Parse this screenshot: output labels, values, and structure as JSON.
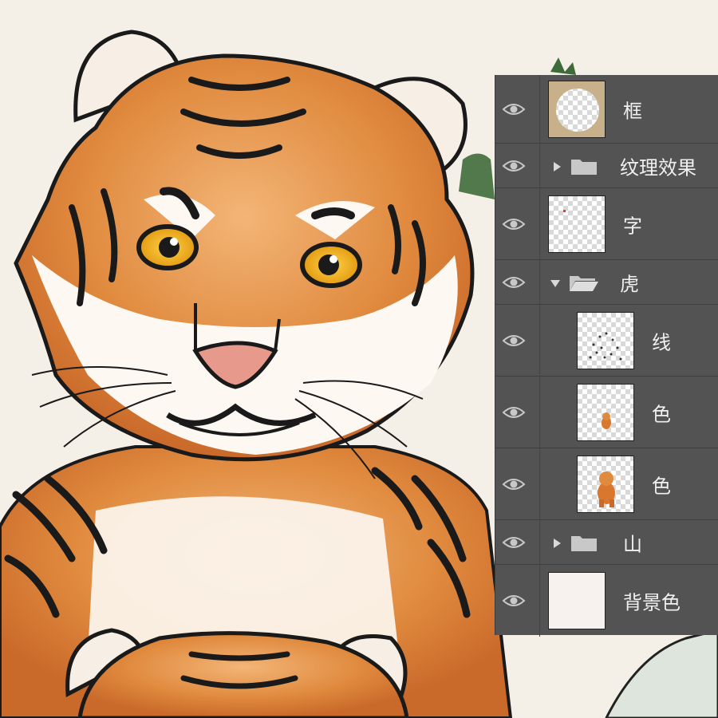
{
  "layers_panel": {
    "layers": [
      {
        "name": "框",
        "kind": "layer",
        "thumbnail": "frame-thumbnail"
      },
      {
        "name": "纹理效果",
        "kind": "group",
        "expanded": false
      },
      {
        "name": "字",
        "kind": "layer",
        "thumbnail": "transparent-thumbnail"
      },
      {
        "name": "虎",
        "kind": "group",
        "expanded": true
      },
      {
        "name": "线",
        "kind": "layer",
        "indented": true,
        "thumbnail": "linework-thumbnail"
      },
      {
        "name": "色",
        "kind": "layer",
        "indented": true,
        "thumbnail": "small-tiger-thumbnail"
      },
      {
        "name": "色",
        "kind": "layer",
        "indented": true,
        "thumbnail": "tiger-color-thumbnail"
      },
      {
        "name": "山",
        "kind": "group",
        "expanded": false
      },
      {
        "name": "背景色",
        "kind": "layer",
        "thumbnail": "background-thumbnail"
      }
    ]
  },
  "colors": {
    "panel_bg": "#535353",
    "tiger_orange": "#d9772f",
    "eye_yellow": "#f2b21a",
    "nose_pink": "#e79a8c",
    "paper": "#f4efe7"
  }
}
